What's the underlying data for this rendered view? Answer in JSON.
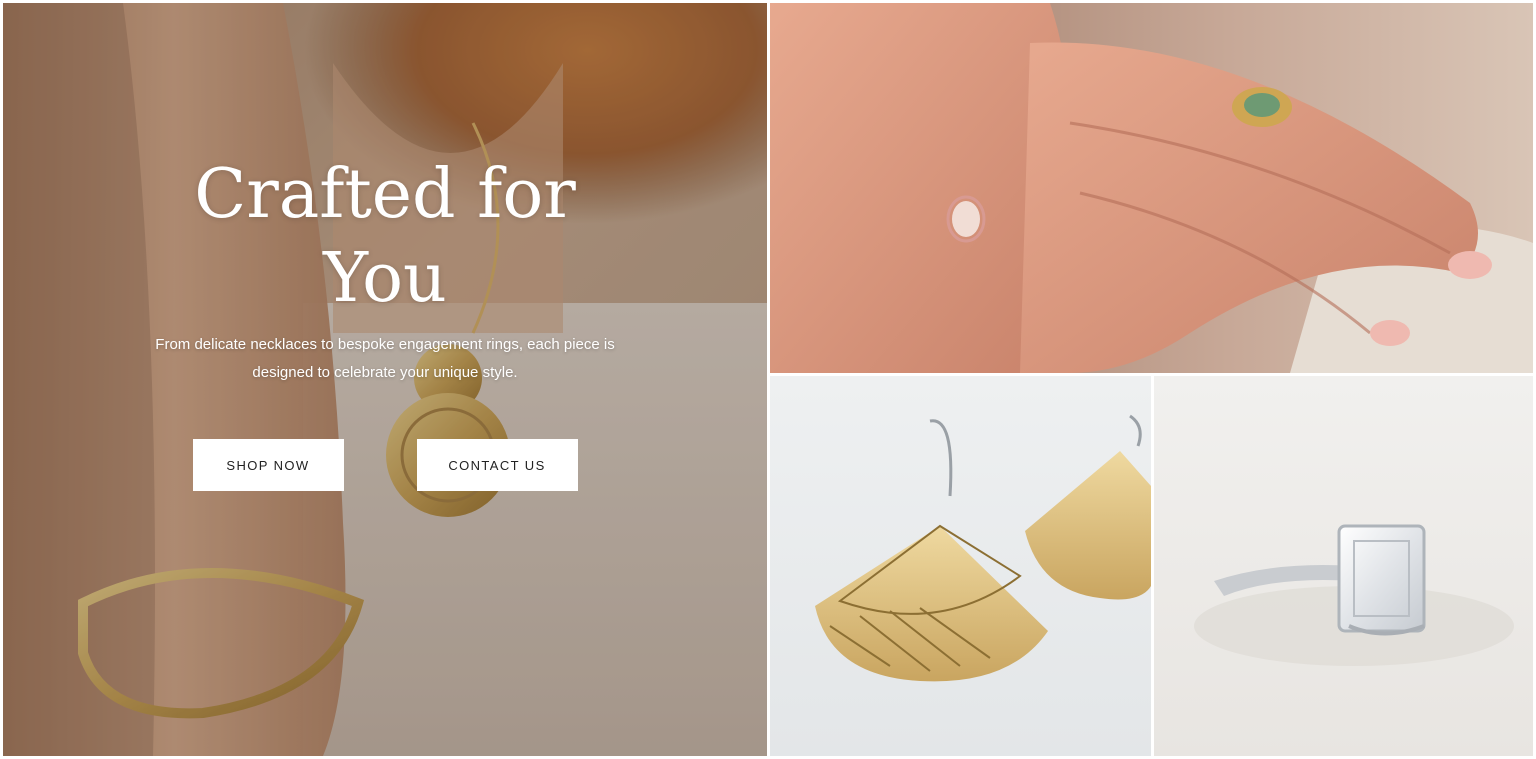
{
  "hero": {
    "title": "Crafted for You",
    "subtitle": "From delicate necklaces to bespoke engagement rings, each piece is designed to celebrate your unique style.",
    "buttons": {
      "shop_label": "SHOP NOW",
      "contact_label": "CONTACT US"
    },
    "image": "woman-wearing-gold-necklace-and-bracelet"
  },
  "gallery": {
    "tiles": [
      {
        "image": "hands-with-engagement-ring-and-green-gemstone-ring"
      },
      {
        "image": "gold-fan-earrings"
      },
      {
        "image": "emerald-cut-solitaire-ring"
      }
    ]
  },
  "colors": {
    "button_bg": "#ffffff",
    "button_text": "#222222",
    "hero_text": "#ffffff"
  }
}
